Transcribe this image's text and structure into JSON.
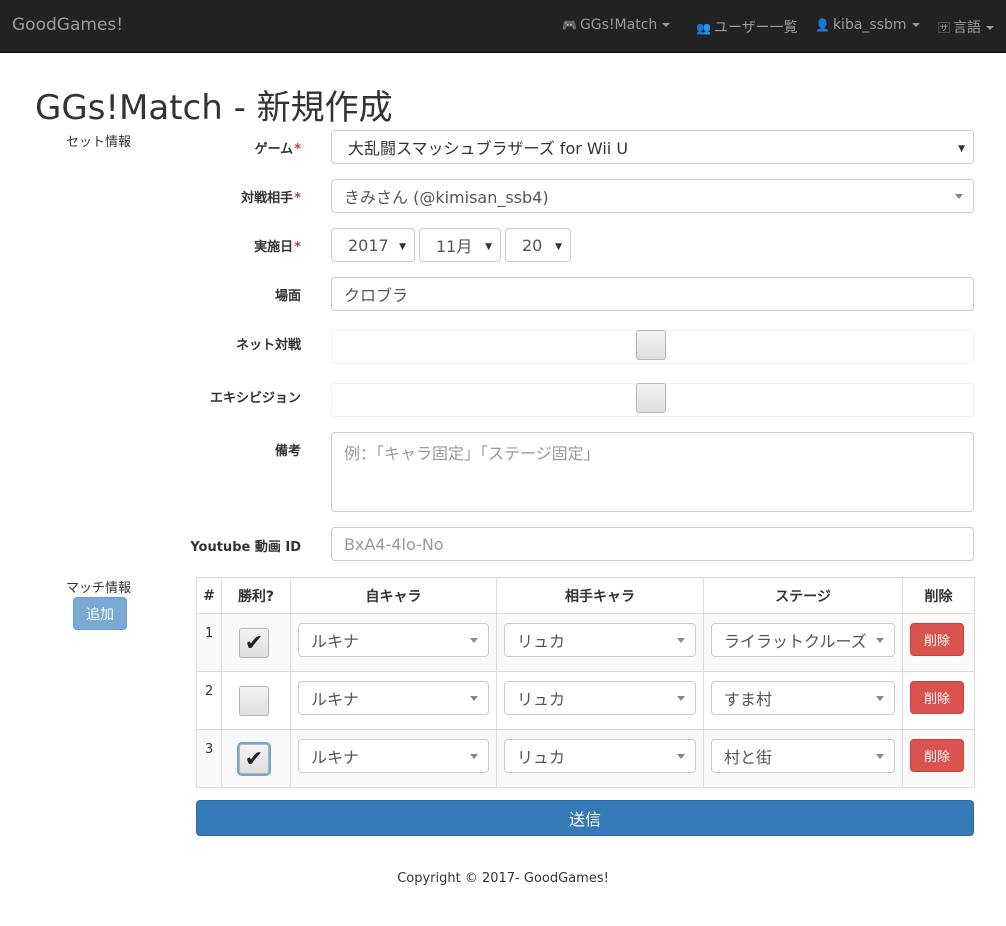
{
  "navbar": {
    "brand": "GoodGames!",
    "items": [
      {
        "label": "GGs!Match",
        "icon": "gamepad-icon",
        "dropdown": true
      },
      {
        "label": "ユーザー一覧",
        "icon": "users-icon",
        "dropdown": false
      },
      {
        "label": "kiba_ssbm",
        "icon": "user-icon",
        "dropdown": true
      },
      {
        "label": "言語",
        "icon": "language-icon",
        "dropdown": true
      }
    ]
  },
  "page_title": "GGs!Match - 新規作成",
  "set_info": {
    "section_label": "セット情報",
    "game": {
      "label": "ゲーム",
      "value": "大乱闘スマッシュブラザーズ for Wii U"
    },
    "opponent": {
      "label": "対戦相手",
      "value": "きみさん (@kimisan_ssb4)"
    },
    "date": {
      "label": "実施日",
      "year": "2017",
      "month": "11月",
      "day": "20"
    },
    "venue": {
      "label": "場面",
      "value": "クロブラ"
    },
    "online": {
      "label": "ネット対戦",
      "checked": false
    },
    "exhibition": {
      "label": "エキシビジョン",
      "checked": false
    },
    "notes": {
      "label": "備考",
      "placeholder": "例：「キャラ固定」「ステージ固定」"
    },
    "youtube": {
      "label": "Youtube 動画 ID",
      "placeholder": "BxA4-4lo-No"
    }
  },
  "match_info": {
    "section_label": "マッチ情報",
    "add_label": "追加",
    "columns": [
      "#",
      "勝利?",
      "自キャラ",
      "相手キャラ",
      "ステージ",
      "削除"
    ],
    "rows": [
      {
        "num": "1",
        "won": true,
        "my_char": "ルキナ",
        "opp_char": "リュカ",
        "stage": "ライラットクルーズ",
        "delete_label": "削除"
      },
      {
        "num": "2",
        "won": false,
        "my_char": "ルキナ",
        "opp_char": "リュカ",
        "stage": "すま村",
        "delete_label": "削除"
      },
      {
        "num": "3",
        "won": true,
        "my_char": "ルキナ",
        "opp_char": "リュカ",
        "stage": "村と街",
        "delete_label": "削除"
      }
    ]
  },
  "submit_label": "送信",
  "footer": "Copyright © 2017- GoodGames!",
  "colors": {
    "navbar": "#222222",
    "primary": "#337ab7",
    "danger": "#d9534f",
    "required": "#a94442"
  }
}
